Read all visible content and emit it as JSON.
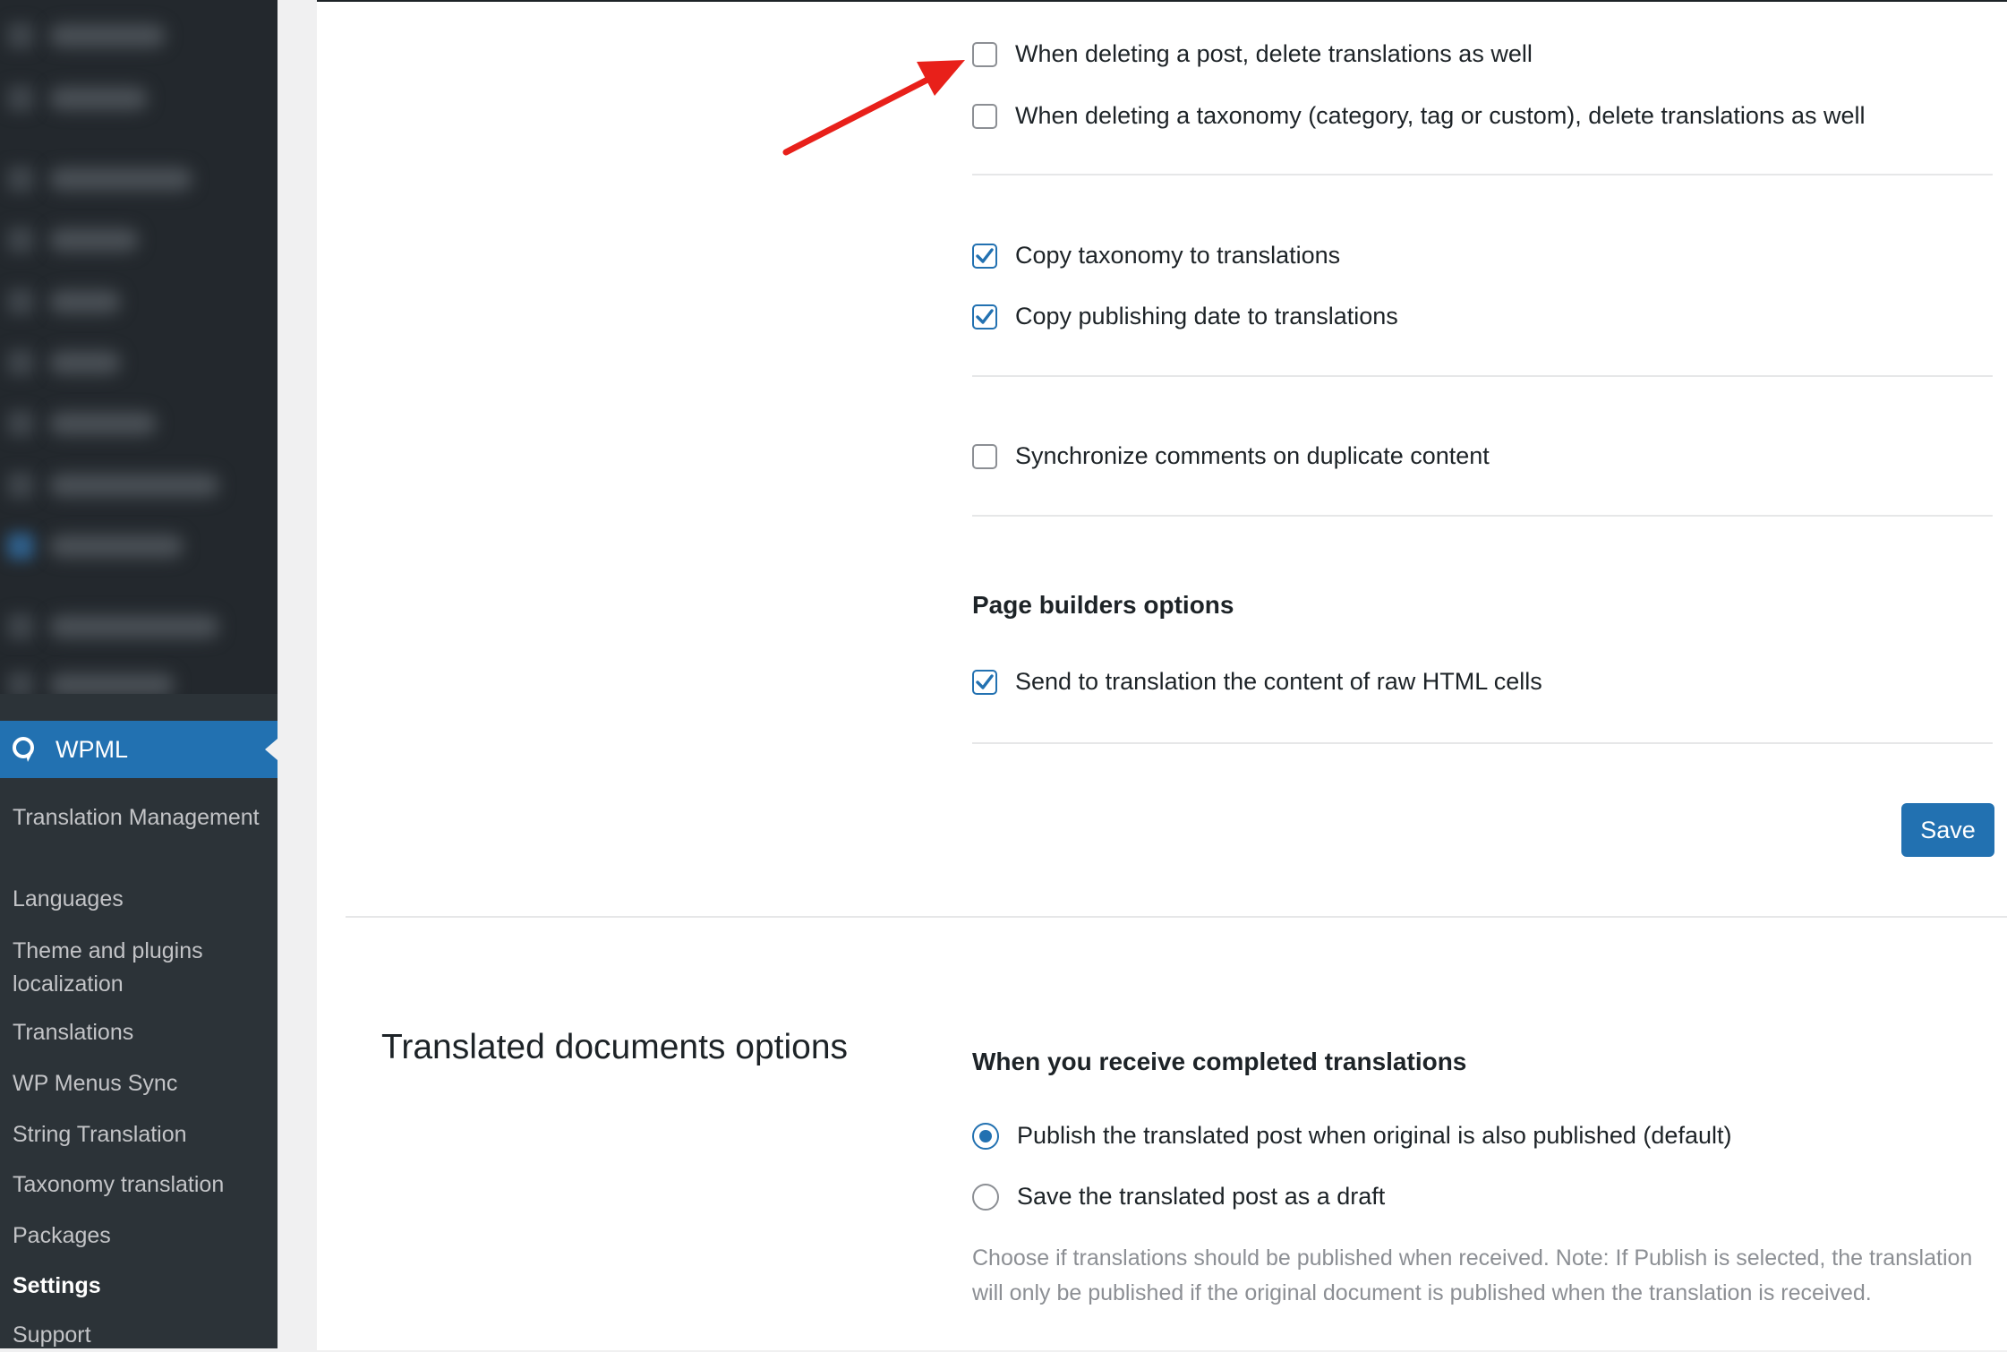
{
  "colors": {
    "accent": "#2271b1",
    "sidebar_bg": "#1d2327",
    "submenu_bg": "#2c3338",
    "annotation_arrow": "#e8201a"
  },
  "sidebar": {
    "active_menu": {
      "label": "WPML",
      "icon": "wpml-logo-icon"
    },
    "submenu": [
      {
        "label": "Translation Management",
        "active": false
      },
      {
        "label": "Languages",
        "active": false
      },
      {
        "label": "Theme and plugins localization",
        "active": false
      },
      {
        "label": "Translations",
        "active": false
      },
      {
        "label": "WP Menus Sync",
        "active": false
      },
      {
        "label": "String Translation",
        "active": false
      },
      {
        "label": "Taxonomy translation",
        "active": false
      },
      {
        "label": "Packages",
        "active": false
      },
      {
        "label": "Settings",
        "active": true
      },
      {
        "label": "Support",
        "active": false
      }
    ]
  },
  "sync_options": {
    "delete_post_translations": {
      "label": "When deleting a post, delete translations as well",
      "checked": false
    },
    "delete_taxonomy_translations": {
      "label": "When deleting a taxonomy (category, tag or custom), delete translations as well",
      "checked": false
    },
    "copy_taxonomy": {
      "label": "Copy taxonomy to translations",
      "checked": true
    },
    "copy_publishing_date": {
      "label": "Copy publishing date to translations",
      "checked": true
    },
    "sync_comments": {
      "label": "Synchronize comments on duplicate content",
      "checked": false
    }
  },
  "page_builders": {
    "heading": "Page builders options",
    "raw_html": {
      "label": "Send to translation the content of raw HTML cells",
      "checked": true
    }
  },
  "save_label": "Save",
  "translated_documents": {
    "title": "Translated documents options",
    "subheading": "When you receive completed translations",
    "options": [
      {
        "label": "Publish the translated post when original is also published (default)",
        "selected": true
      },
      {
        "label": "Save the translated post as a draft",
        "selected": false
      }
    ],
    "note": "Choose if translations should be published when received. Note: If Publish is selected, the translation will only be published if the original document is published when the translation is received."
  }
}
